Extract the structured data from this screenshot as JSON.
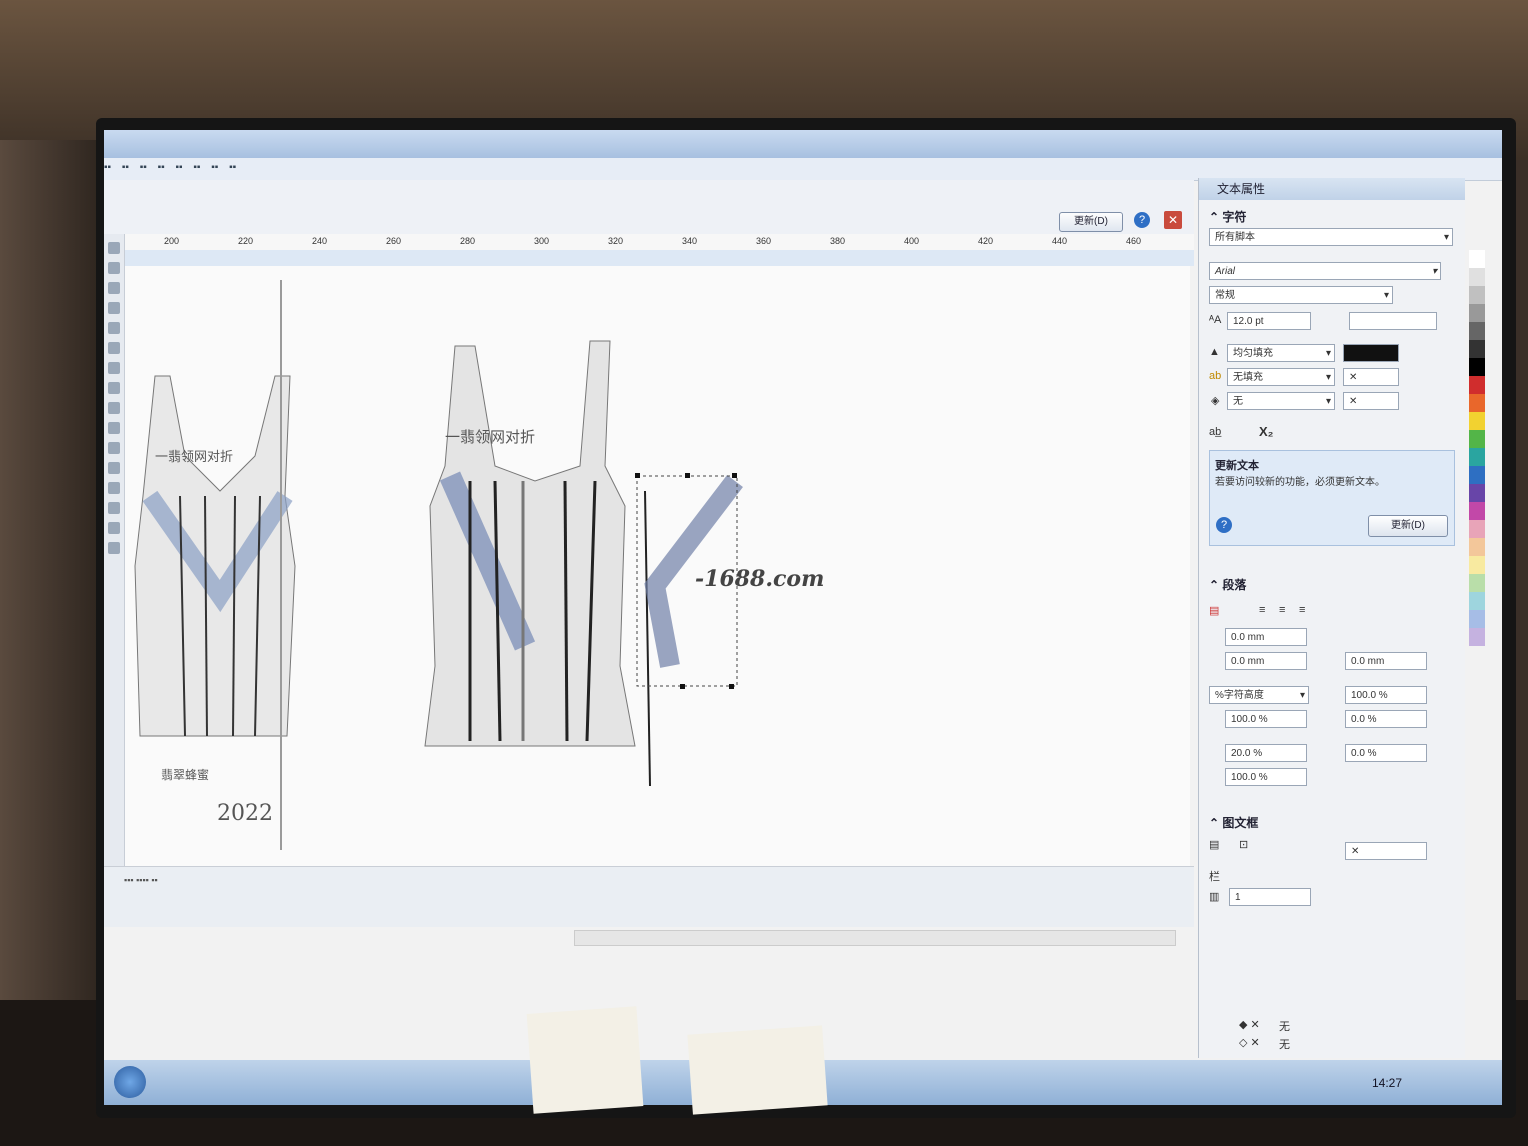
{
  "app": {
    "update_button": "更新(D)"
  },
  "ruler": {
    "ticks": [
      "200",
      "220",
      "240",
      "260",
      "280",
      "300",
      "320",
      "340",
      "360",
      "380",
      "400",
      "420",
      "440",
      "460"
    ]
  },
  "canvas": {
    "watermark_1": "一翡领网对折",
    "watermark_2": "一翡领网对折",
    "watermark_url": "-1688.com",
    "left_note_1": "翡翠蜂蜜",
    "left_note_2": "2022"
  },
  "panel": {
    "title": "文本属性",
    "character": {
      "heading": "字符",
      "script": "所有脚本",
      "font": "Arial",
      "style": "常规",
      "size": "12.0 pt",
      "fill_type": "均匀填充",
      "bg_fill": "无填充",
      "outline": "无"
    },
    "update_text": {
      "title": "更新文本",
      "desc": "若要访问较新的功能，必须更新文本。",
      "button": "更新(D)"
    },
    "paragraph": {
      "heading": "段落",
      "indent_1": "0.0 mm",
      "indent_2": "0.0 mm",
      "indent_3": "0.0 mm",
      "spacing_unit": "%字符高度",
      "line_1": "100.0 %",
      "line_2": "100.0 %",
      "line_3": "0.0 %",
      "char_spacing": "20.0 %",
      "word_spacing": "0.0 %",
      "lang_spacing": "100.0 %"
    },
    "frame": {
      "heading": "图文框",
      "columns_label": "栏",
      "columns": "1"
    },
    "fill_status": "无",
    "outline_status": "无"
  },
  "taskbar": {
    "clock": "14:27"
  },
  "colors": {
    "accent": "#2f6fc5",
    "close": "#c94b3d"
  }
}
